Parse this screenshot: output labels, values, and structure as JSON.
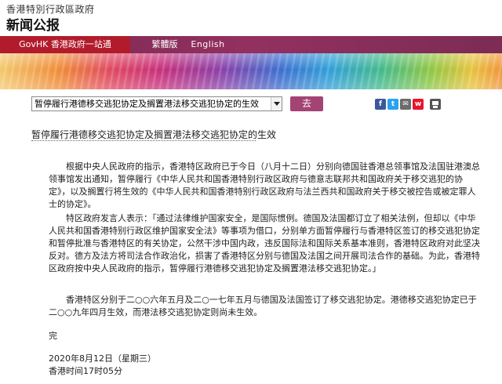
{
  "header": {
    "gov_name": "香港特別行政區政府",
    "page_title": "新闻公报"
  },
  "nav": {
    "gov_portal": "GovHK 香港政府一站通",
    "traditional": "繁體版",
    "english": "English"
  },
  "toolbar": {
    "select_value": "暂停履行港德移交逃犯协定及搁置港法移交逃犯协定的生效",
    "go_label": "去"
  },
  "share_icons": [
    "facebook-icon",
    "twitter-icon",
    "email-icon",
    "weibo-icon",
    "print-icon"
  ],
  "article": {
    "title": "暂停履行港德移交逃犯协定及搁置港法移交逃犯协定的生效",
    "paragraphs": [
      "　　根据中央人民政府的指示，香港特区政府已于今日（八月十二日）分别向德国驻香港总领事馆及法国驻港澳总领事馆发出通知，暂停履行《中华人民共和国香港特别行政区政府与德意志联邦共和国政府关于移交逃犯的协定》，以及搁置行将生效的《中华人民共和国香港特别行政区政府与法兰西共和国政府关于移交被控告或被定罪人士的协定》。",
      "　　特区政府发言人表示：「通过法律维护国家安全，是国际惯例。德国及法国都订立了相关法例，但却以《中华人民共和国香港特别行政区维护国家安全法》等事项为借口，分别单方面暂停履行与香港特区签订的移交逃犯协定和暂停批准与香港特区的有关协定，公然干涉中国内政，违反国际法和国际关系基本准则，香港特区政府对此坚决反对。德方及法方将司法合作政治化，损害了香港特区分别与德国及法国之间开展司法合作的基础。为此，香港特区政府按中央人民政府的指示，暂停履行港德移交逃犯协定及搁置港法移交逃犯协定。」",
      "　　香港特区分别于二○○六年五月及二○一七年五月与德国及法国签订了移交逃犯协定。港德移交逃犯协定已于二○○九年四月生效，而港法移交逃犯协定则尚未生效。",
      "完"
    ],
    "date": "2020年8月12日（星期三）",
    "time": "香港时间17时05分"
  },
  "colors": {
    "nav_bar": "#8a2d5b",
    "gov_portal_bg": "#b21b2b",
    "go_button": "#a34474"
  }
}
